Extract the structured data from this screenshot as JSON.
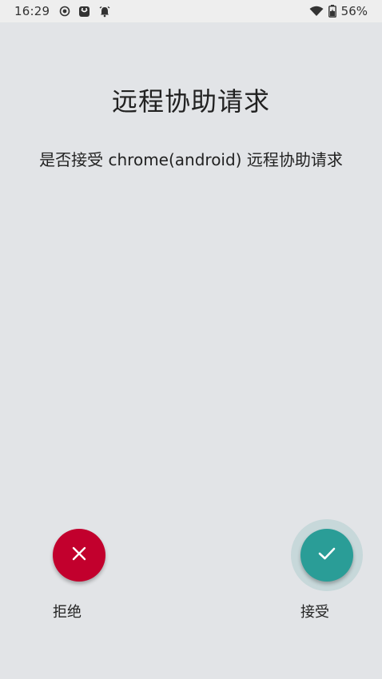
{
  "status_bar": {
    "time": "16:29",
    "left_icons": [
      "record-icon",
      "app-notification-icon",
      "alarm-icon"
    ],
    "right_icons": [
      "wifi-icon",
      "battery-charging-icon"
    ],
    "battery": "56%"
  },
  "dialog": {
    "title": "远程协助请求",
    "message": "是否接受 chrome(android) 远程协助请求"
  },
  "actions": {
    "reject": {
      "label": "拒绝",
      "icon": "close-icon",
      "color": "#c2002d"
    },
    "accept": {
      "label": "接受",
      "icon": "check-icon",
      "color": "#2a9d97"
    }
  }
}
